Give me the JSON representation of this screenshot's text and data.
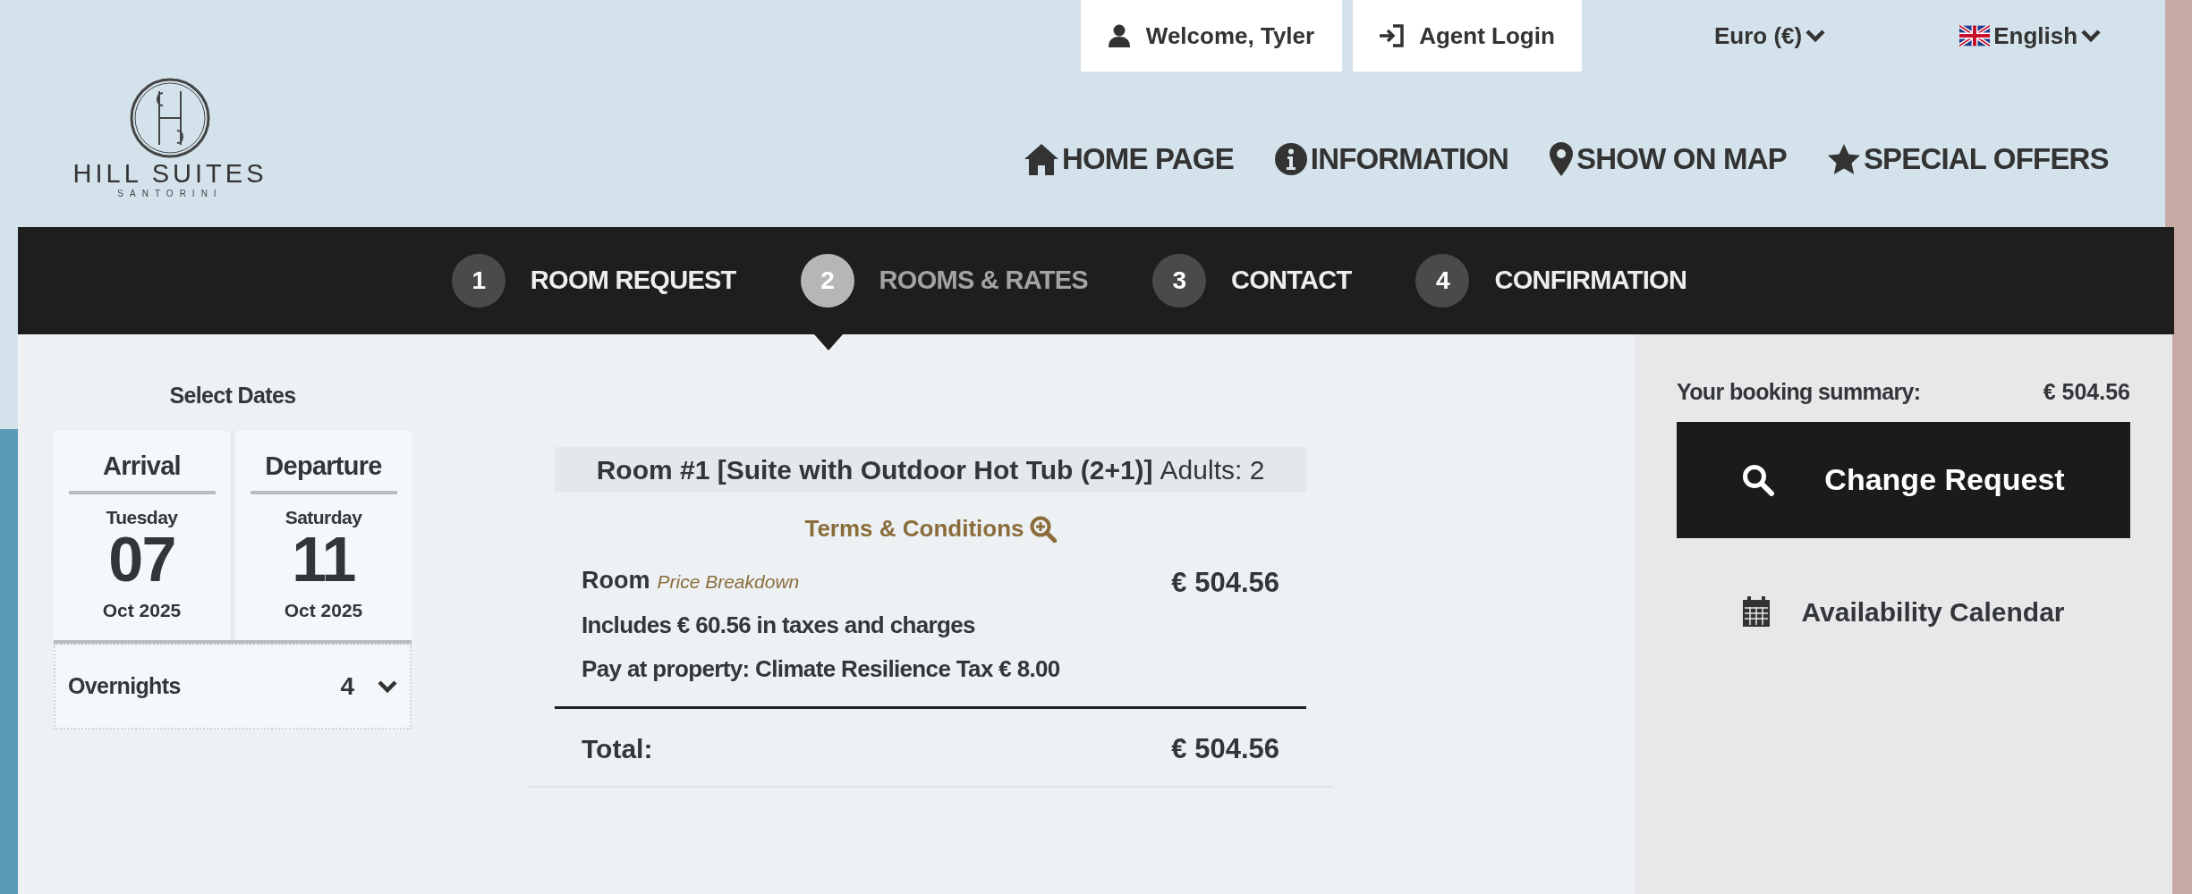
{
  "top_bar": {
    "account": "Welcome, Tyler",
    "agent_login": "Agent Login",
    "currency": "Euro (€)",
    "language": "English"
  },
  "logo": {
    "name": "HILL SUITES",
    "subtitle": "SANTORINI"
  },
  "nav": [
    {
      "label": "HOME PAGE",
      "kind": "home"
    },
    {
      "label": "INFORMATION",
      "kind": "info"
    },
    {
      "label": "SHOW ON MAP",
      "kind": "map"
    },
    {
      "label": "SPECIAL OFFERS",
      "kind": "star"
    }
  ],
  "steps": [
    {
      "number": "1",
      "label": "ROOM REQUEST",
      "selected": false
    },
    {
      "number": "2",
      "label": "ROOMS & RATES",
      "selected": true
    },
    {
      "number": "3",
      "label": "CONTACT",
      "selected": false
    },
    {
      "number": "4",
      "label": "CONFIRMATION",
      "selected": false
    }
  ],
  "dates": {
    "title": "Select Dates",
    "arrival": {
      "label": "Arrival",
      "weekday": "Tuesday",
      "day": "07",
      "month": "Oct 2025"
    },
    "departure": {
      "label": "Departure",
      "weekday": "Saturday",
      "day": "11",
      "month": "Oct 2025"
    },
    "overnights": {
      "label": "Overnights",
      "value": "4"
    }
  },
  "room": {
    "title": "Room #1 [Suite with Outdoor Hot Tub (2+1)]",
    "adults": "Adults: 2",
    "terms": "Terms & Conditions",
    "room_label": "Room",
    "price_breakdown": "Price Breakdown",
    "price": "€ 504.56",
    "includes": "Includes € 60.56 in taxes and charges",
    "pay_at_property": "Pay at property: Climate Resilience Tax € 8.00",
    "total_label": "Total:",
    "total": "€ 504.56"
  },
  "summary": {
    "label": "Your booking summary:",
    "amount": "€ 504.56",
    "change_button": "Change Request",
    "calendar_link": "Availability Calendar"
  }
}
